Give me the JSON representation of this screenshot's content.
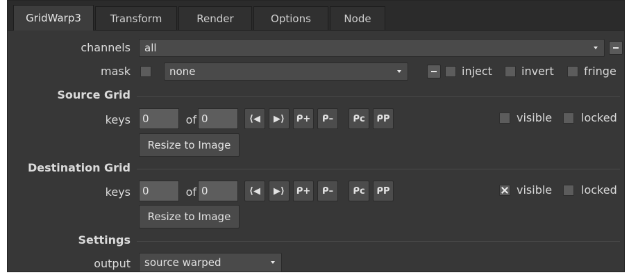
{
  "tabs": [
    {
      "label": "GridWarp3",
      "active": true
    },
    {
      "label": "Transform",
      "active": false
    },
    {
      "label": "Render",
      "active": false
    },
    {
      "label": "Options",
      "active": false
    },
    {
      "label": "Node",
      "active": false
    }
  ],
  "channels": {
    "label": "channels",
    "value": "all"
  },
  "mask": {
    "label": "mask",
    "value": "none",
    "inject": "inject",
    "invert": "invert",
    "fringe": "fringe"
  },
  "source_grid": {
    "title": "Source Grid",
    "keys_label": "keys",
    "keys_value": "0",
    "of_label": "of",
    "of_value": "0",
    "key_buttons": [
      "⟨◀",
      "▶⟩",
      "ᑭ+",
      "ᑭ–",
      "ᑭc",
      "ᑭP"
    ],
    "visible": "visible",
    "visible_checked": false,
    "locked": "locked",
    "resize": "Resize to Image"
  },
  "destination_grid": {
    "title": "Destination Grid",
    "keys_label": "keys",
    "keys_value": "0",
    "of_label": "of",
    "of_value": "0",
    "key_buttons": [
      "⟨◀",
      "▶⟩",
      "ᑭ+",
      "ᑭ–",
      "ᑭc",
      "ᑭP"
    ],
    "visible": "visible",
    "visible_checked": true,
    "locked": "locked",
    "resize": "Resize to Image"
  },
  "settings": {
    "title": "Settings",
    "output_label": "output",
    "output_value": "source warped"
  },
  "colors": {
    "panel": "#373737",
    "tabbar": "#2b2b2b",
    "field": "#5d5d5d",
    "text": "#dadada"
  }
}
